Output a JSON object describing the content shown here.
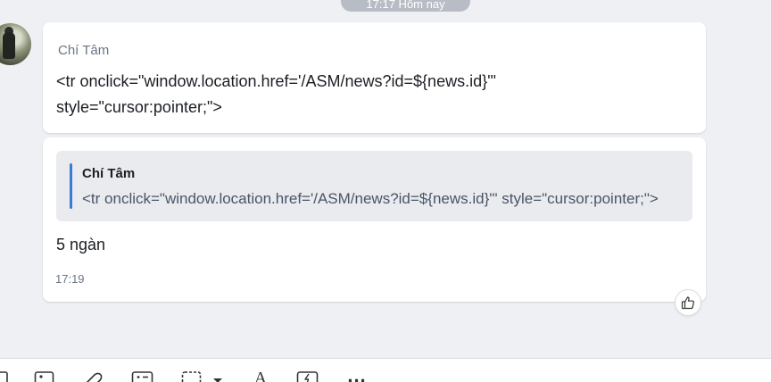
{
  "date_separator": "17:17 Hôm nay",
  "messages": [
    {
      "sender": "Chí Tâm",
      "text_line1": "<tr onclick=\"window.location.href='/ASM/news?id=${news.id}'\"",
      "text_line2": "style=\"cursor:pointer;\">"
    },
    {
      "quote": {
        "sender": "Chí Tâm",
        "text": "<tr onclick=\"window.location.href='/ASM/news?id=${news.id}'\" style=\"cursor:pointer;\">"
      },
      "text": "5 ngàn",
      "time": "17:19"
    }
  ],
  "reaction": {
    "icon": "thumbs-up-icon"
  },
  "toolbar": {
    "icons": [
      "sticker-icon",
      "image-icon",
      "attachment-icon",
      "contact-card-icon",
      "screenshot-icon",
      "dropdown-caret-icon",
      "text-format-icon",
      "quick-message-icon",
      "more-icon"
    ],
    "format_label": "A",
    "more_label": "..."
  },
  "colors": {
    "background": "#eef0f3",
    "bubble": "#ffffff",
    "quote_bar": "#3b7bd6",
    "muted_text": "#6b7585"
  }
}
